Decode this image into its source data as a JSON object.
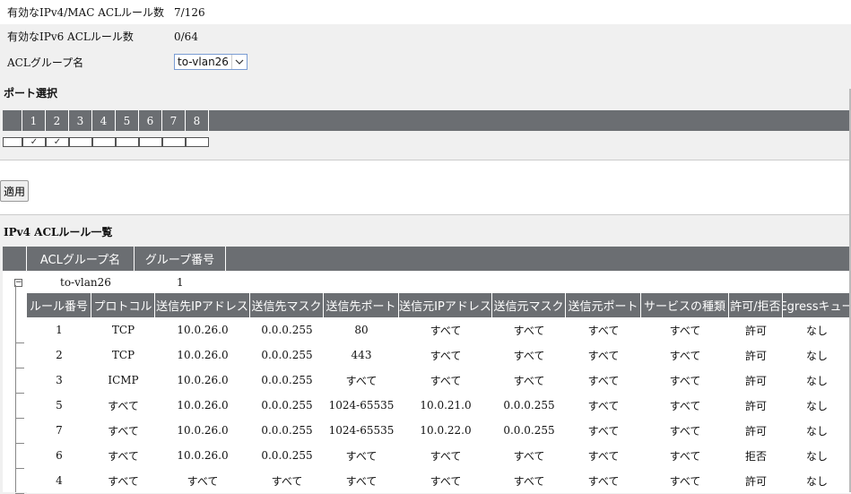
{
  "info": {
    "ipv4_mac_label": "有効なIPv4/MAC ACLルール数",
    "ipv4_mac_value": "7/126",
    "ipv6_label": "有効なIPv6 ACLルール数",
    "ipv6_value": "0/64",
    "group_label": "ACLグループ名",
    "group_selected": "to-vlan26"
  },
  "port_section": {
    "title": "ポート選択",
    "ports": [
      {
        "num": "1",
        "checked": true
      },
      {
        "num": "2",
        "checked": true
      },
      {
        "num": "3",
        "checked": false
      },
      {
        "num": "4",
        "checked": false
      },
      {
        "num": "5",
        "checked": false
      },
      {
        "num": "6",
        "checked": false
      },
      {
        "num": "7",
        "checked": false
      },
      {
        "num": "8",
        "checked": false
      }
    ]
  },
  "apply_label": "適用",
  "list_title": "IPv4 ACLルール一覧",
  "group_table": {
    "headers": [
      "ACLグループ名",
      "グループ番号"
    ],
    "row": {
      "name": "to-vlan26",
      "number": "1"
    }
  },
  "rules_table": {
    "headers": [
      "ルール番号",
      "プロトコル",
      "送信先IPアドレス",
      "送信先マスク",
      "送信先ポート",
      "送信元IPアドレス",
      "送信元マスク",
      "送信元ポート",
      "サービスの種類",
      "許可/拒否",
      "Egressキュー"
    ],
    "rows": [
      [
        "1",
        "TCP",
        "10.0.26.0",
        "0.0.0.255",
        "80",
        "すべて",
        "すべて",
        "すべて",
        "すべて",
        "許可",
        "なし"
      ],
      [
        "2",
        "TCP",
        "10.0.26.0",
        "0.0.0.255",
        "443",
        "すべて",
        "すべて",
        "すべて",
        "すべて",
        "許可",
        "なし"
      ],
      [
        "3",
        "ICMP",
        "10.0.26.0",
        "0.0.0.255",
        "すべて",
        "すべて",
        "すべて",
        "すべて",
        "すべて",
        "許可",
        "なし"
      ],
      [
        "5",
        "すべて",
        "10.0.26.0",
        "0.0.0.255",
        "1024-65535",
        "10.0.21.0",
        "0.0.0.255",
        "すべて",
        "すべて",
        "許可",
        "なし"
      ],
      [
        "7",
        "すべて",
        "10.0.26.0",
        "0.0.0.255",
        "1024-65535",
        "10.0.22.0",
        "0.0.0.255",
        "すべて",
        "すべて",
        "許可",
        "なし"
      ],
      [
        "6",
        "すべて",
        "10.0.26.0",
        "0.0.0.255",
        "すべて",
        "すべて",
        "すべて",
        "すべて",
        "すべて",
        "拒否",
        "なし"
      ],
      [
        "4",
        "すべて",
        "すべて",
        "すべて",
        "すべて",
        "すべて",
        "すべて",
        "すべて",
        "すべて",
        "許可",
        "なし"
      ]
    ]
  }
}
